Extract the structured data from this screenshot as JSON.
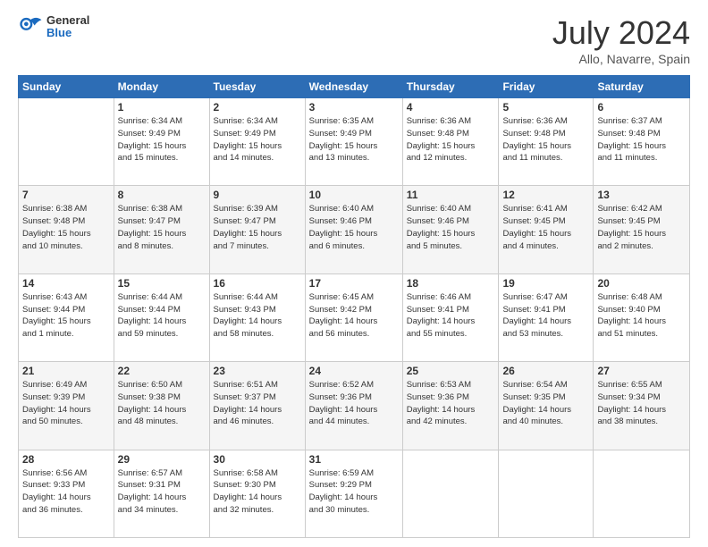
{
  "header": {
    "logo": {
      "general": "General",
      "blue": "Blue"
    },
    "title": "July 2024",
    "location": "Allo, Navarre, Spain"
  },
  "weekdays": [
    "Sunday",
    "Monday",
    "Tuesday",
    "Wednesday",
    "Thursday",
    "Friday",
    "Saturday"
  ],
  "weeks": [
    [
      {
        "day": "",
        "info": ""
      },
      {
        "day": "1",
        "info": "Sunrise: 6:34 AM\nSunset: 9:49 PM\nDaylight: 15 hours\nand 15 minutes."
      },
      {
        "day": "2",
        "info": "Sunrise: 6:34 AM\nSunset: 9:49 PM\nDaylight: 15 hours\nand 14 minutes."
      },
      {
        "day": "3",
        "info": "Sunrise: 6:35 AM\nSunset: 9:49 PM\nDaylight: 15 hours\nand 13 minutes."
      },
      {
        "day": "4",
        "info": "Sunrise: 6:36 AM\nSunset: 9:48 PM\nDaylight: 15 hours\nand 12 minutes."
      },
      {
        "day": "5",
        "info": "Sunrise: 6:36 AM\nSunset: 9:48 PM\nDaylight: 15 hours\nand 11 minutes."
      },
      {
        "day": "6",
        "info": "Sunrise: 6:37 AM\nSunset: 9:48 PM\nDaylight: 15 hours\nand 11 minutes."
      }
    ],
    [
      {
        "day": "7",
        "info": "Sunrise: 6:38 AM\nSunset: 9:48 PM\nDaylight: 15 hours\nand 10 minutes."
      },
      {
        "day": "8",
        "info": "Sunrise: 6:38 AM\nSunset: 9:47 PM\nDaylight: 15 hours\nand 8 minutes."
      },
      {
        "day": "9",
        "info": "Sunrise: 6:39 AM\nSunset: 9:47 PM\nDaylight: 15 hours\nand 7 minutes."
      },
      {
        "day": "10",
        "info": "Sunrise: 6:40 AM\nSunset: 9:46 PM\nDaylight: 15 hours\nand 6 minutes."
      },
      {
        "day": "11",
        "info": "Sunrise: 6:40 AM\nSunset: 9:46 PM\nDaylight: 15 hours\nand 5 minutes."
      },
      {
        "day": "12",
        "info": "Sunrise: 6:41 AM\nSunset: 9:45 PM\nDaylight: 15 hours\nand 4 minutes."
      },
      {
        "day": "13",
        "info": "Sunrise: 6:42 AM\nSunset: 9:45 PM\nDaylight: 15 hours\nand 2 minutes."
      }
    ],
    [
      {
        "day": "14",
        "info": "Sunrise: 6:43 AM\nSunset: 9:44 PM\nDaylight: 15 hours\nand 1 minute."
      },
      {
        "day": "15",
        "info": "Sunrise: 6:44 AM\nSunset: 9:44 PM\nDaylight: 14 hours\nand 59 minutes."
      },
      {
        "day": "16",
        "info": "Sunrise: 6:44 AM\nSunset: 9:43 PM\nDaylight: 14 hours\nand 58 minutes."
      },
      {
        "day": "17",
        "info": "Sunrise: 6:45 AM\nSunset: 9:42 PM\nDaylight: 14 hours\nand 56 minutes."
      },
      {
        "day": "18",
        "info": "Sunrise: 6:46 AM\nSunset: 9:41 PM\nDaylight: 14 hours\nand 55 minutes."
      },
      {
        "day": "19",
        "info": "Sunrise: 6:47 AM\nSunset: 9:41 PM\nDaylight: 14 hours\nand 53 minutes."
      },
      {
        "day": "20",
        "info": "Sunrise: 6:48 AM\nSunset: 9:40 PM\nDaylight: 14 hours\nand 51 minutes."
      }
    ],
    [
      {
        "day": "21",
        "info": "Sunrise: 6:49 AM\nSunset: 9:39 PM\nDaylight: 14 hours\nand 50 minutes."
      },
      {
        "day": "22",
        "info": "Sunrise: 6:50 AM\nSunset: 9:38 PM\nDaylight: 14 hours\nand 48 minutes."
      },
      {
        "day": "23",
        "info": "Sunrise: 6:51 AM\nSunset: 9:37 PM\nDaylight: 14 hours\nand 46 minutes."
      },
      {
        "day": "24",
        "info": "Sunrise: 6:52 AM\nSunset: 9:36 PM\nDaylight: 14 hours\nand 44 minutes."
      },
      {
        "day": "25",
        "info": "Sunrise: 6:53 AM\nSunset: 9:36 PM\nDaylight: 14 hours\nand 42 minutes."
      },
      {
        "day": "26",
        "info": "Sunrise: 6:54 AM\nSunset: 9:35 PM\nDaylight: 14 hours\nand 40 minutes."
      },
      {
        "day": "27",
        "info": "Sunrise: 6:55 AM\nSunset: 9:34 PM\nDaylight: 14 hours\nand 38 minutes."
      }
    ],
    [
      {
        "day": "28",
        "info": "Sunrise: 6:56 AM\nSunset: 9:33 PM\nDaylight: 14 hours\nand 36 minutes."
      },
      {
        "day": "29",
        "info": "Sunrise: 6:57 AM\nSunset: 9:31 PM\nDaylight: 14 hours\nand 34 minutes."
      },
      {
        "day": "30",
        "info": "Sunrise: 6:58 AM\nSunset: 9:30 PM\nDaylight: 14 hours\nand 32 minutes."
      },
      {
        "day": "31",
        "info": "Sunrise: 6:59 AM\nSunset: 9:29 PM\nDaylight: 14 hours\nand 30 minutes."
      },
      {
        "day": "",
        "info": ""
      },
      {
        "day": "",
        "info": ""
      },
      {
        "day": "",
        "info": ""
      }
    ]
  ]
}
